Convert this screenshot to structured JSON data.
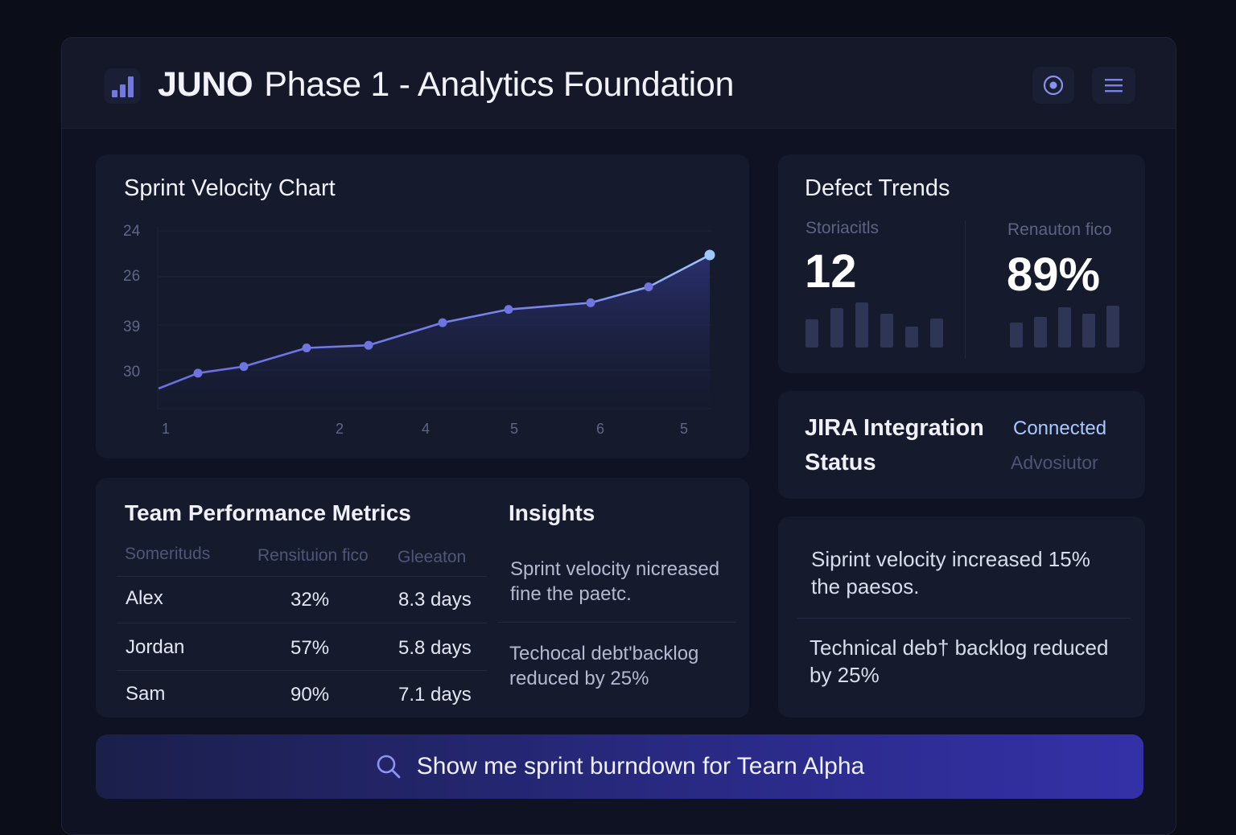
{
  "header": {
    "brand": "JUNO",
    "title": "Phase 1 - Analytics Foundation"
  },
  "icons": {
    "logo": "bar-chart-icon",
    "action1": "target-icon",
    "action2": "menu-icon"
  },
  "velocity": {
    "title": "Sprint Velocity Chart"
  },
  "chart_data": {
    "type": "area",
    "title": "Sprint Velocity Chart",
    "y_tick_labels": [
      "24",
      "26",
      "39",
      "30"
    ],
    "x_tick_labels": [
      "1",
      "2",
      "4",
      "5",
      "6",
      "5"
    ],
    "values": [
      0.0,
      0.11,
      0.16,
      0.3,
      0.32,
      0.49,
      0.59,
      0.64,
      0.76,
      1.0
    ],
    "values_note": "",
    "grid": true,
    "colors": {
      "line": "#7c82e8",
      "fill": "#262b63",
      "last_point": "#9fc7ff"
    }
  },
  "defects": {
    "title": "Defect Trends",
    "left_label": "Storiacitls",
    "left_value": "12",
    "right_label": "Renauton fico",
    "right_value": "89%",
    "left_bars": [
      0.62,
      0.88,
      1.0,
      0.75,
      0.47,
      0.64
    ],
    "right_bars": [
      0.55,
      0.67,
      0.9,
      0.75,
      0.93
    ]
  },
  "jira": {
    "title_line1": "JIRA Integration",
    "title_line2": "Status",
    "status": "Connected",
    "sub": "Advosiutor",
    "status_color": "#a9c8ff"
  },
  "team": {
    "title": "Team Performance Metrics",
    "columns": [
      "Somerituds",
      "Rensituion fico",
      "Gleeaton"
    ],
    "rows": [
      {
        "name": "Alex",
        "rate": "32%",
        "time": "8.3 days"
      },
      {
        "name": "Jordan",
        "rate": "57%",
        "time": "5.8 days"
      },
      {
        "name": "Sam",
        "rate": "90%",
        "time": "7.1 days"
      }
    ]
  },
  "insights": {
    "title": "Insights",
    "items": [
      "Sprint velocity nicreased fine the paetc.",
      "Techocal debt'backlog reduced by 25%"
    ]
  },
  "summary": {
    "items": [
      "Siprint velocity increased 15% the  paesos.",
      "Technical deb† backlog reduced by 25%"
    ]
  },
  "search": {
    "query": "Show me sprint burndown for Tearn Alpha"
  }
}
